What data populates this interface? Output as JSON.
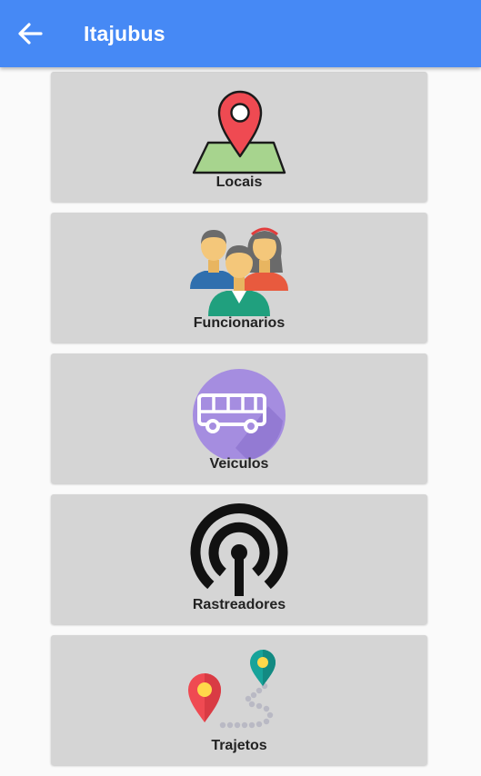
{
  "appbar": {
    "title": "Itajubus",
    "back_icon": "arrow-left-icon",
    "color": "#4689f5"
  },
  "menu": {
    "items": [
      {
        "label": "Locais",
        "icon": "map-pin-icon"
      },
      {
        "label": "Funcionarios",
        "icon": "people-group-icon"
      },
      {
        "label": "Veiculos",
        "icon": "bus-icon"
      },
      {
        "label": "Rastreadores",
        "icon": "tracker-signal-icon"
      },
      {
        "label": "Trajetos",
        "icon": "route-icon"
      }
    ]
  },
  "colors": {
    "card_background": "#d5d5d5",
    "page_background": "#fafafa"
  }
}
